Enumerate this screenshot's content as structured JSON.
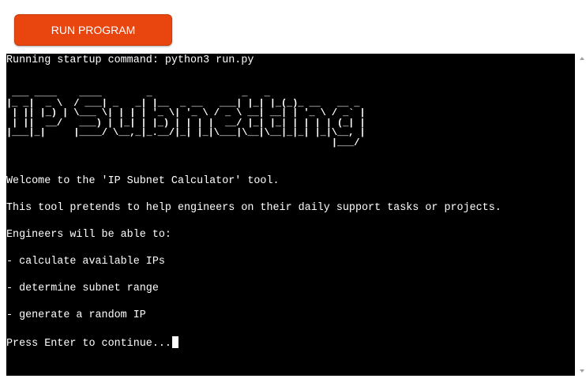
{
  "toolbar": {
    "run_label": "RUN PROGRAM"
  },
  "terminal": {
    "startup": "Running startup command: python3 run.py",
    "banner": " ___ ____    ____        _                _   _             \n|_ _|  _ \\  / ___| _   _| |__  _ __   ___| |_| |_(_)_ __   __ _ \n | || |_) | \\___ \\| | | | '_ \\| '_ \\ / _ \\ __| __| | '_ \\ / _` |\n | ||  __/   ___) | |_| | |_) | | | |  __/ |_| |_| | | | | (_| |\n|___|_|     |____/ \\__,_|_.__/|_| |_|\\___|\\__|\\__|_|_| |_|\\__, |\n                                                          |___/ ",
    "welcome": "Welcome to the 'IP Subnet Calculator' tool.",
    "description": "This tool pretends to help engineers on their daily support tasks or projects.",
    "capabilities_intro": "Engineers will be able to:",
    "capabilities": [
      "- calculate available IPs",
      "- determine subnet range",
      "- generate a random IP"
    ],
    "prompt": "Press Enter to continue..."
  },
  "colors": {
    "accent": "#e8450f",
    "terminal_bg": "#000000",
    "terminal_fg": "#ffffff"
  }
}
